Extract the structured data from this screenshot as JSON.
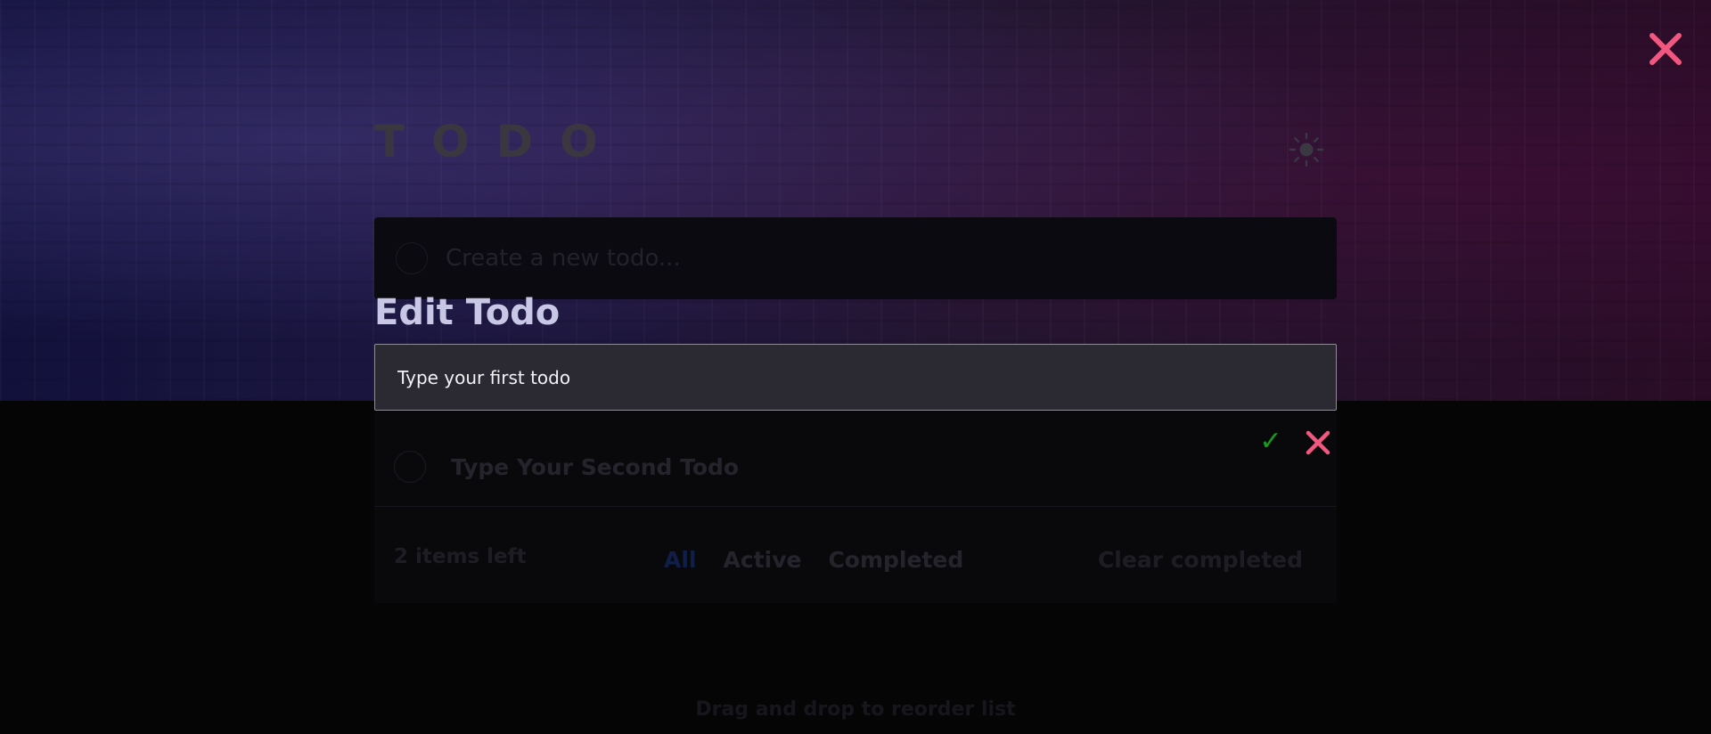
{
  "app": {
    "title": "TODO"
  },
  "new_todo": {
    "placeholder": "Create a new todo..."
  },
  "todos": [
    {
      "label": "Type Your Second Todo",
      "completed": false
    }
  ],
  "footer": {
    "items_left": "2 items left",
    "filters": [
      {
        "label": "All",
        "active": true
      },
      {
        "label": "Active",
        "active": false
      },
      {
        "label": "Completed",
        "active": false
      }
    ],
    "clear_completed": "Clear completed"
  },
  "drag_hint": "Drag and drop to reorder list",
  "modal": {
    "title": "Edit Todo",
    "input_value": "Type your first todo",
    "close_icon": "close-icon",
    "confirm_icon": "check-icon",
    "cancel_icon": "close-icon"
  },
  "colors": {
    "accent_close": "#f2577f",
    "confirm": "#1a9a1a",
    "active_filter": "#0f1f4a"
  }
}
